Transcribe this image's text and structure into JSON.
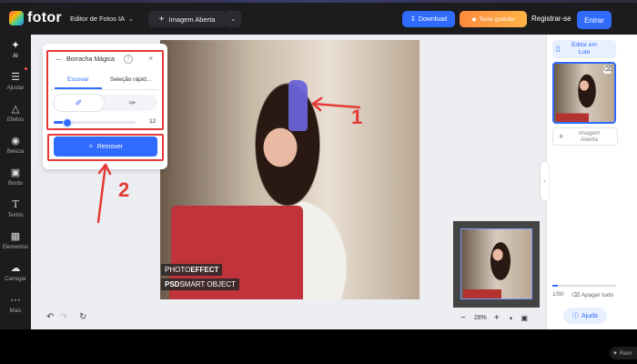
{
  "topbar": {
    "logo_text": "fotor",
    "editor_label": "Editor de Fotos IA",
    "open_image_label": "Imagem Aberta",
    "download_label": "Download",
    "trial_label": "Teste gratuito",
    "register_label": "Registrar-se",
    "enter_label": "Entrar"
  },
  "sidebar": {
    "items": [
      {
        "label": "AI",
        "icon": "sparkles-icon"
      },
      {
        "label": "Ajustar",
        "icon": "sliders-icon"
      },
      {
        "label": "Efeitos",
        "icon": "flask-icon"
      },
      {
        "label": "Beleza",
        "icon": "eye-icon"
      },
      {
        "label": "Bordo",
        "icon": "frame-icon"
      },
      {
        "label": "Textos",
        "icon": "text-icon"
      },
      {
        "label": "Elementos",
        "icon": "shapes-icon"
      },
      {
        "label": "Carregar",
        "icon": "cloud-upload-icon"
      },
      {
        "label": "Mais",
        "icon": "more-icon"
      }
    ]
  },
  "panel": {
    "title": "Borracha Mágica",
    "tabs": [
      "Escovar",
      "Seleção rápid..."
    ],
    "active_tab": 0,
    "brush_size": "12",
    "brush_size_fraction": 0.13,
    "remove_label": "Remover"
  },
  "photo": {
    "text_line1_a": "PHOTO ",
    "text_line1_b": "EFFECT",
    "text_line2_a": "PSD ",
    "text_line2_b": "SMART OBJECT"
  },
  "annotations": {
    "num1": "1",
    "num2": "2"
  },
  "zoom": {
    "level": "28%"
  },
  "right_panel": {
    "batch_label_1": "Editor em",
    "batch_label_2": "Lote",
    "open_image_1": "Imagem",
    "open_image_2": "Aberta",
    "page_count": "1/50",
    "clear_all": "Apagar tudo",
    "help_label": "Ajuda"
  },
  "bottom": {
    "remove_chip": "Rem"
  },
  "colors": {
    "accent": "#2f6bff",
    "annotation_red": "#e53935",
    "mask": "#6a63d8"
  }
}
